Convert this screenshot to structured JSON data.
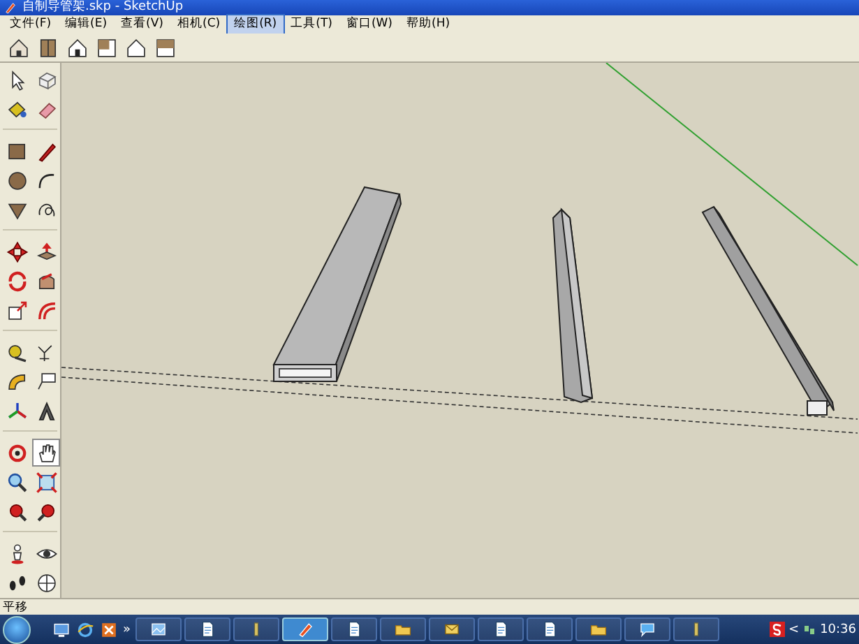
{
  "window": {
    "title": "自制导管架.skp - SketchUp"
  },
  "menu": [
    {
      "label": "文件(F)",
      "selected": false
    },
    {
      "label": "编辑(E)",
      "selected": false
    },
    {
      "label": "查看(V)",
      "selected": false
    },
    {
      "label": "相机(C)",
      "selected": false
    },
    {
      "label": "绘图(R)",
      "selected": true
    },
    {
      "label": "工具(T)",
      "selected": false
    },
    {
      "label": "窗口(W)",
      "selected": false
    },
    {
      "label": "帮助(H)",
      "selected": false
    }
  ],
  "views_toolbar": [
    {
      "kind": "iso"
    },
    {
      "kind": "top"
    },
    {
      "kind": "front"
    },
    {
      "kind": "right"
    },
    {
      "kind": "back"
    },
    {
      "kind": "left"
    }
  ],
  "tool_palette": [
    {
      "tools": [
        {
          "kind": "select",
          "selected": false
        },
        {
          "kind": "component",
          "selected": false
        },
        {
          "kind": "paint",
          "selected": false
        },
        {
          "kind": "eraser",
          "selected": false
        }
      ]
    },
    {
      "tools": [
        {
          "kind": "rectangle",
          "selected": false
        },
        {
          "kind": "line",
          "selected": false
        },
        {
          "kind": "circle",
          "selected": false
        },
        {
          "kind": "arc",
          "selected": false
        },
        {
          "kind": "polygon",
          "selected": false
        },
        {
          "kind": "freehand",
          "selected": false
        }
      ]
    },
    {
      "tools": [
        {
          "kind": "move",
          "selected": false
        },
        {
          "kind": "pushpull",
          "selected": false
        },
        {
          "kind": "rotate",
          "selected": false
        },
        {
          "kind": "followme",
          "selected": false
        },
        {
          "kind": "scale",
          "selected": false
        },
        {
          "kind": "offset",
          "selected": false
        }
      ]
    },
    {
      "tools": [
        {
          "kind": "tape",
          "selected": false
        },
        {
          "kind": "dimension",
          "selected": false
        },
        {
          "kind": "protractor",
          "selected": false
        },
        {
          "kind": "text",
          "selected": false
        },
        {
          "kind": "axes",
          "selected": false
        },
        {
          "kind": "text3d",
          "selected": false
        }
      ]
    },
    {
      "tools": [
        {
          "kind": "orbit",
          "selected": false
        },
        {
          "kind": "pan",
          "selected": true
        },
        {
          "kind": "zoom",
          "selected": false
        },
        {
          "kind": "zoomwindow",
          "selected": false
        },
        {
          "kind": "zoomextents",
          "selected": false
        },
        {
          "kind": "previous",
          "selected": false
        }
      ]
    },
    {
      "tools": [
        {
          "kind": "position",
          "selected": false
        },
        {
          "kind": "look",
          "selected": false
        },
        {
          "kind": "walk",
          "selected": false
        },
        {
          "kind": "section",
          "selected": false
        }
      ]
    }
  ],
  "status_bar": {
    "text": "平移"
  },
  "taskbar": {
    "overflow": "»",
    "tray_expand": "<",
    "clock": "10:36",
    "quick_launch": [
      {
        "kind": "desktop"
      },
      {
        "kind": "browser"
      },
      {
        "kind": "app"
      }
    ],
    "buttons": [
      {
        "kind": "image",
        "selected": false
      },
      {
        "kind": "document",
        "selected": false
      },
      {
        "kind": "tool",
        "selected": false
      },
      {
        "kind": "sketchup",
        "selected": true
      },
      {
        "kind": "document",
        "selected": false
      },
      {
        "kind": "folder",
        "selected": false
      },
      {
        "kind": "mail",
        "selected": false
      },
      {
        "kind": "document",
        "selected": false
      },
      {
        "kind": "document",
        "selected": false
      },
      {
        "kind": "folder",
        "selected": false
      },
      {
        "kind": "chat",
        "selected": false
      },
      {
        "kind": "tool",
        "selected": false
      }
    ]
  }
}
